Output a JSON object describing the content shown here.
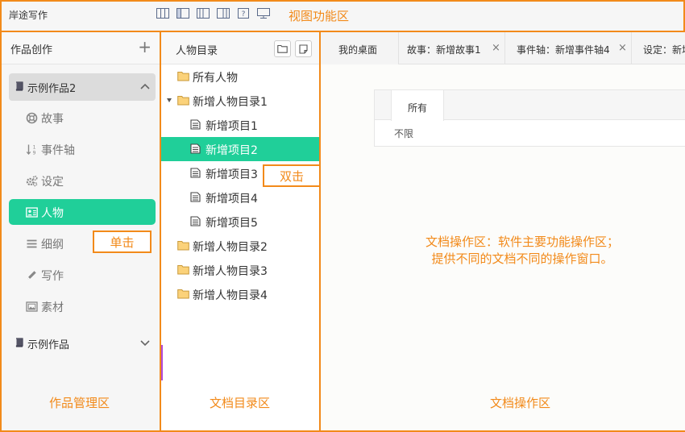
{
  "app": {
    "title": "岸途写作"
  },
  "view_toolbar": {
    "buttons": [
      {
        "name": "layout-1-icon"
      },
      {
        "name": "layout-2-icon"
      },
      {
        "name": "layout-3-icon"
      },
      {
        "name": "layout-4-icon"
      },
      {
        "name": "help-icon"
      },
      {
        "name": "monitor-icon"
      }
    ]
  },
  "annotations": {
    "view_area": "视图功能区",
    "works_area": "作品管理区",
    "catalog_area": "文档目录区",
    "doc_area": "文档操作区",
    "single_click": "单击",
    "double_click": "双击",
    "doc_desc_line1": "文档操作区：软件主要功能操作区；",
    "doc_desc_line2": "提供不同的文档不同的操作窗口。"
  },
  "works_panel": {
    "title": "作品创作",
    "works": [
      {
        "label": "示例作品2",
        "expanded": true,
        "items": [
          {
            "label": "故事",
            "icon": "lifebuoy-icon",
            "active": false
          },
          {
            "label": "事件轴",
            "icon": "sort-icon",
            "active": false
          },
          {
            "label": "设定",
            "icon": "gears-icon",
            "active": false
          },
          {
            "label": "人物",
            "icon": "contact-card-icon",
            "active": true
          },
          {
            "label": "细纲",
            "icon": "list-icon",
            "active": false
          },
          {
            "label": "写作",
            "icon": "pencil-icon",
            "active": false
          },
          {
            "label": "素材",
            "icon": "image-frame-icon",
            "active": false
          }
        ]
      },
      {
        "label": "示例作品",
        "expanded": false
      }
    ]
  },
  "catalog_panel": {
    "title": "人物目录",
    "tree": [
      {
        "label": "所有人物",
        "type": "folder",
        "level": 0
      },
      {
        "label": "新增人物目录1",
        "type": "folder",
        "level": 0,
        "expanded": true
      },
      {
        "label": "新增项目1",
        "type": "doc",
        "level": 1
      },
      {
        "label": "新增项目2",
        "type": "doc",
        "level": 1,
        "selected": true
      },
      {
        "label": "新增项目3",
        "type": "doc",
        "level": 1
      },
      {
        "label": "新增项目4",
        "type": "doc",
        "level": 1
      },
      {
        "label": "新增项目5",
        "type": "doc",
        "level": 1
      },
      {
        "label": "新增人物目录2",
        "type": "folder",
        "level": 0
      },
      {
        "label": "新增人物目录3",
        "type": "folder",
        "level": 0
      },
      {
        "label": "新增人物目录4",
        "type": "folder",
        "level": 0
      }
    ]
  },
  "doc_panel": {
    "tabs": [
      {
        "label": "我的桌面",
        "closable": false
      },
      {
        "label": "故事：新增故事1",
        "closable": true
      },
      {
        "label": "事件轴：新增事件轴4",
        "closable": true
      },
      {
        "label": "设定：新增",
        "closable": false
      }
    ],
    "filter_tab": "所有",
    "filter_value": "不限"
  },
  "colors": {
    "accent": "#20cf99",
    "annotation": "#f28a1a"
  }
}
